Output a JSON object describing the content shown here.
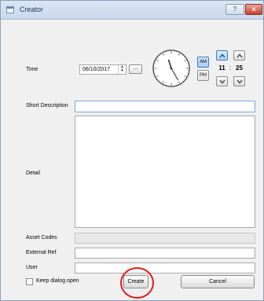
{
  "window": {
    "title": "Creator",
    "help_label": "?",
    "close_label": "✕"
  },
  "time": {
    "label": "Time",
    "date_value": "06/10/2017",
    "date_picker_label": "...",
    "am_label": "AM",
    "pm_label": "PM",
    "selected_period": "AM",
    "hour": "11",
    "separator": ":",
    "minute": "25",
    "clock_hour": 11,
    "clock_minute": 25
  },
  "fields": {
    "short_description_label": "Short Description",
    "detail_label": "Detail",
    "asset_codes_label": "Asset Codes",
    "external_ref_label": "External Ref",
    "user_label": "User"
  },
  "footer": {
    "keep_open_label": "Keep dialog open",
    "keep_open_checked": false,
    "create_label": "Create",
    "cancel_label": "Cancel"
  },
  "colors": {
    "highlight": "#e21b1b",
    "accent": "#3b7bbf"
  }
}
